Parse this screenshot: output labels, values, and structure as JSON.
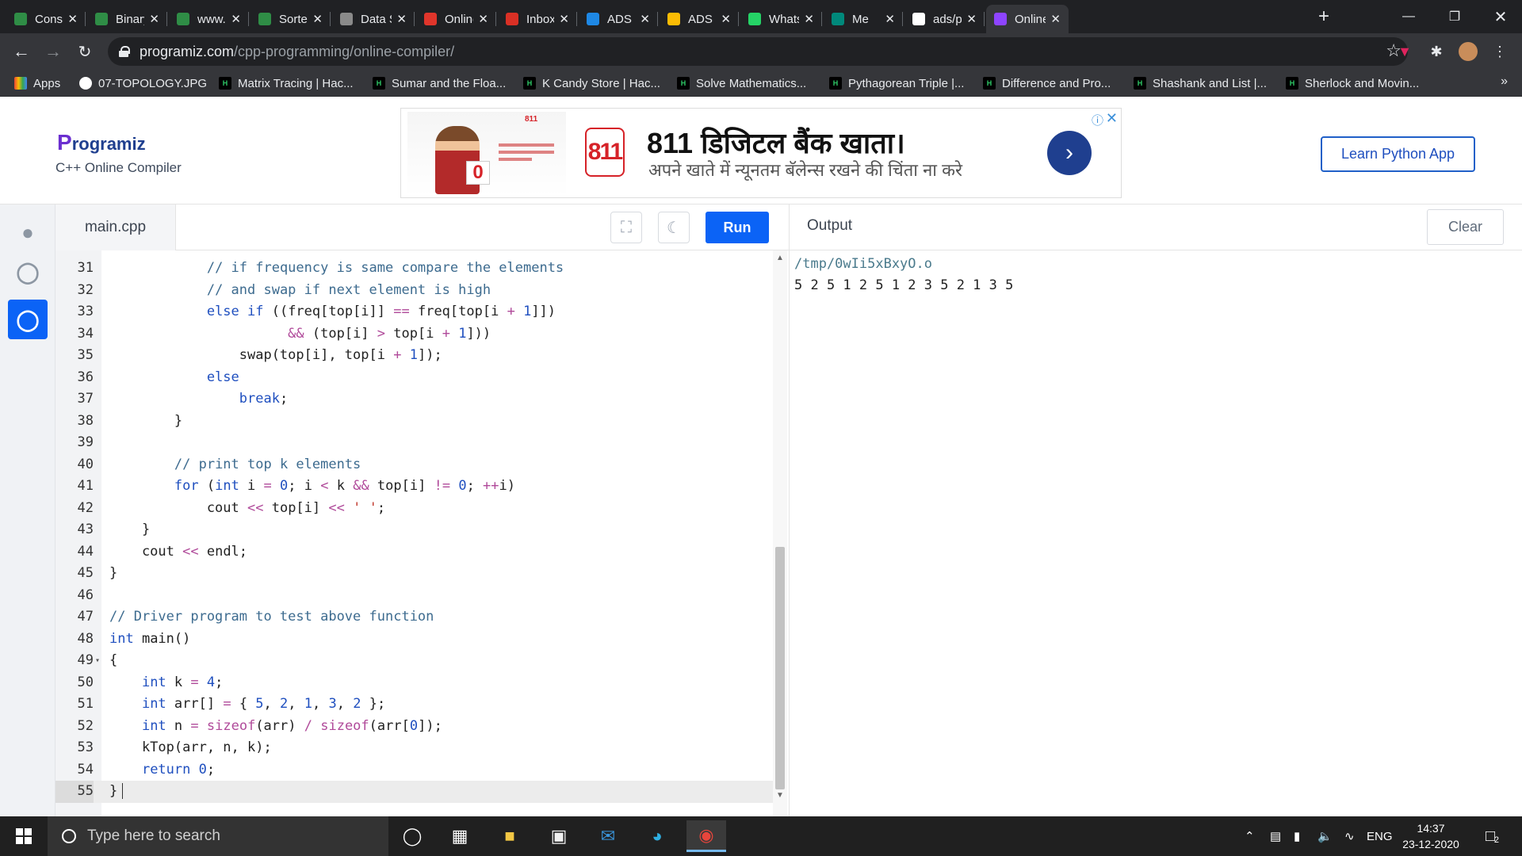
{
  "browser": {
    "tabs": [
      {
        "label": "Constr",
        "fav": "gfg",
        "color": "#2f8d46"
      },
      {
        "label": "Binary",
        "fav": "gfg",
        "color": "#2f8d46"
      },
      {
        "label": "www.g",
        "fav": "gfg",
        "color": "#2f8d46"
      },
      {
        "label": "Sorted",
        "fav": "gfg",
        "color": "#2f8d46"
      },
      {
        "label": "Data S",
        "fav": "globe",
        "color": "#8a8a8a"
      },
      {
        "label": "Online",
        "fav": "u",
        "color": "#e0352b"
      },
      {
        "label": "Inbox (",
        "fav": "M",
        "color": "#d93025"
      },
      {
        "label": "ADS L/",
        "fav": "classroom",
        "color": "#1e88e5"
      },
      {
        "label": "ADS L/",
        "fav": "drive",
        "color": "#fbbc04"
      },
      {
        "label": "Whats",
        "fav": "whatsapp",
        "color": "#25d366"
      },
      {
        "label": "Me",
        "fav": "meet",
        "color": "#00897b"
      },
      {
        "label": "ads/pr",
        "fav": "github",
        "color": "#ffffff"
      },
      {
        "label": "Online",
        "fav": "programiz",
        "color": "#8e44ff"
      }
    ],
    "url_domain": "programiz.com",
    "url_path": "/cpp-programming/online-compiler/",
    "bookmarks": [
      {
        "label": "Apps",
        "icon": "apps-grid-icon"
      },
      {
        "label": "07-TOPOLOGY.JPG",
        "icon": "github-icon"
      },
      {
        "label": "Matrix Tracing | Hac...",
        "icon": "hackerrank-icon"
      },
      {
        "label": "Sumar and the Floa...",
        "icon": "hackerrank-icon"
      },
      {
        "label": "K Candy Store | Hac...",
        "icon": "hackerrank-icon"
      },
      {
        "label": "Solve Mathematics...",
        "icon": "hackerrank-icon"
      },
      {
        "label": "Pythagorean Triple |...",
        "icon": "hackerrank-icon"
      },
      {
        "label": "Difference and Pro...",
        "icon": "hackerrank-icon"
      },
      {
        "label": "Shashank and List |...",
        "icon": "hackerrank-icon"
      },
      {
        "label": "Sherlock and Movin...",
        "icon": "hackerrank-icon"
      }
    ],
    "bookmarks_more": "»"
  },
  "site": {
    "logo": "rogramiz",
    "logo_initial": "P",
    "subtitle": "C++ Online Compiler",
    "ad": {
      "badge": "811",
      "small_brand": "811",
      "title": "811 डिजिटल बैंक खाता।",
      "subtitle": "अपने खाते में न्यूनतम बॅलेन्स रखने की चिंता ना करे",
      "card_digit": "0"
    },
    "learn_button": "Learn Python App"
  },
  "editor": {
    "file_name": "main.cpp",
    "run_label": "Run",
    "lines": [
      {
        "n": "31",
        "html": "            <span class='c'>// if frequency is same compare the elements</span>"
      },
      {
        "n": "32",
        "html": "            <span class='c'>// and swap if next element is high</span>"
      },
      {
        "n": "33",
        "html": "            <span class='k'>else if</span> ((freq[top[i]] <span class='o'>==</span> freq[top[i <span class='o'>+</span> <span class='n'>1</span>]])"
      },
      {
        "n": "34",
        "html": "                      <span class='o'>&amp;&amp;</span> (top[i] <span class='o'>&gt;</span> top[i <span class='o'>+</span> <span class='n'>1</span>]))"
      },
      {
        "n": "35",
        "html": "                swap(top[i], top[i <span class='o'>+</span> <span class='n'>1</span>]);"
      },
      {
        "n": "36",
        "html": "            <span class='k'>else</span>"
      },
      {
        "n": "37",
        "html": "                <span class='k'>break</span>;"
      },
      {
        "n": "38",
        "html": "        }"
      },
      {
        "n": "39",
        "html": ""
      },
      {
        "n": "40",
        "html": "        <span class='c'>// print top k elements</span>"
      },
      {
        "n": "41",
        "html": "        <span class='k'>for</span> (<span class='k'>int</span> i <span class='o'>=</span> <span class='n'>0</span>; i <span class='o'>&lt;</span> k <span class='o'>&amp;&amp;</span> top[i] <span class='o'>!=</span> <span class='n'>0</span>; <span class='o'>++</span>i)"
      },
      {
        "n": "42",
        "html": "            cout <span class='o'>&lt;&lt;</span> top[i] <span class='o'>&lt;&lt;</span> <span class='s'>' '</span>;"
      },
      {
        "n": "43",
        "html": "    }"
      },
      {
        "n": "44",
        "html": "    cout <span class='o'>&lt;&lt;</span> endl;"
      },
      {
        "n": "45",
        "html": "}"
      },
      {
        "n": "46",
        "html": ""
      },
      {
        "n": "47",
        "html": "<span class='c'>// Driver program to test above function</span>"
      },
      {
        "n": "48",
        "html": "<span class='k'>int</span> main()"
      },
      {
        "n": "49",
        "html": "{",
        "fold": true
      },
      {
        "n": "50",
        "html": "    <span class='k'>int</span> k <span class='o'>=</span> <span class='n'>4</span>;"
      },
      {
        "n": "51",
        "html": "    <span class='k'>int</span> arr[] <span class='o'>=</span> { <span class='n'>5</span>, <span class='n'>2</span>, <span class='n'>1</span>, <span class='n'>3</span>, <span class='n'>2</span> };"
      },
      {
        "n": "52",
        "html": "    <span class='k'>int</span> n <span class='o'>=</span> <span class='o'>sizeof</span>(arr) <span class='o'>/</span> <span class='o'>sizeof</span>(arr[<span class='n'>0</span>]);"
      },
      {
        "n": "53",
        "html": "    kTop(arr, n, k);"
      },
      {
        "n": "54",
        "html": "    <span class='k'>return</span> <span class='n'>0</span>;"
      },
      {
        "n": "55",
        "html": "}",
        "active": true
      }
    ]
  },
  "output": {
    "title": "Output",
    "clear_label": "Clear",
    "path": "/tmp/0wIi5xBxyO.o",
    "result": "5 2 5 1 2 5 1 2 3 5 2 1 3 5"
  },
  "taskbar": {
    "search_placeholder": "Type here to search",
    "language": "ENG",
    "time": "14:37",
    "date": "23-12-2020",
    "notifications": "2"
  }
}
